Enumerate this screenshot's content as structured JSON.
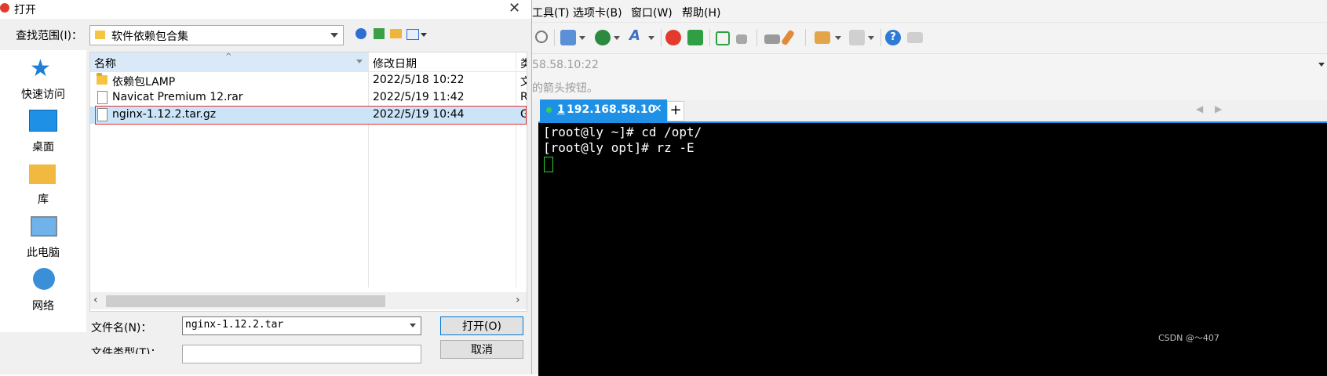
{
  "dialog": {
    "title": "打开",
    "look_in_label": "查找范围(I)：",
    "look_in_value": "软件依赖包合集",
    "sidebar": [
      {
        "label": "快速访问",
        "icon": "star-icon"
      },
      {
        "label": "桌面",
        "icon": "desktop-icon"
      },
      {
        "label": "库",
        "icon": "library-icon"
      },
      {
        "label": "此电脑",
        "icon": "computer-icon"
      },
      {
        "label": "网络",
        "icon": "network-icon"
      }
    ],
    "columns": {
      "name": "名称",
      "modified": "修改日期",
      "type": "类"
    },
    "files": [
      {
        "name": "依赖包LAMP",
        "modified": "2022/5/18 10:22",
        "type": "文",
        "kind": "folder"
      },
      {
        "name": "Navicat Premium 12.rar",
        "modified": "2022/5/19 11:42",
        "type": "R",
        "kind": "file"
      },
      {
        "name": "nginx-1.12.2.tar.gz",
        "modified": "2022/5/19 10:44",
        "type": "G",
        "kind": "file",
        "selected": true
      }
    ],
    "filename_label": "文件名(N)：",
    "filename_value": "nginx-1.12.2.tar",
    "filetype_label": "文件类型(T)：",
    "open_label": "打开(O)",
    "cancel_label": "取消"
  },
  "terminal_app": {
    "menu": [
      "工具(T)",
      "选项卡(B)",
      "窗口(W)",
      "帮助(H)"
    ],
    "address": "58.58.10:22",
    "hint": "的箭头按钮。",
    "tab": {
      "index": "1",
      "host": "192.168.58.10"
    },
    "lines": [
      "[root@ly ~]# cd /opt/",
      "[root@ly opt]# rz -E"
    ],
    "accent_color": "#1e90e6",
    "cursor_color": "#2bd22b"
  },
  "watermark": "CSDN @～407"
}
